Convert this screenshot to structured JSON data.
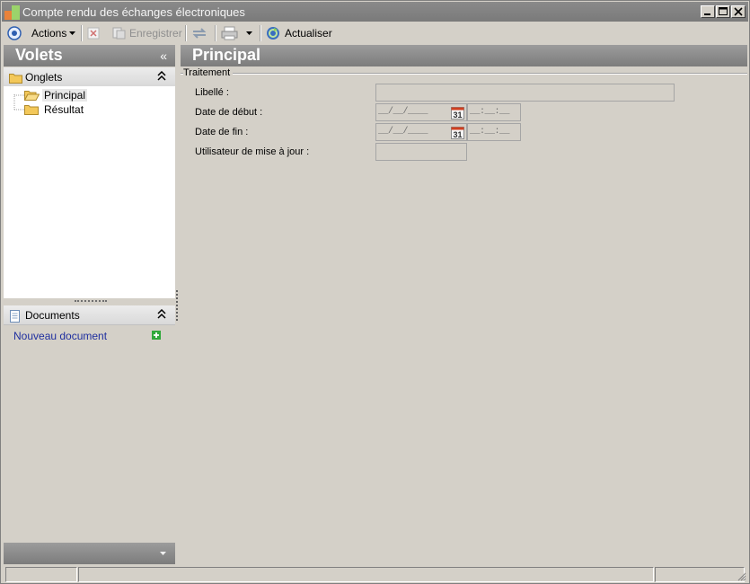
{
  "window": {
    "title": "Compte rendu des échanges électroniques"
  },
  "toolbar": {
    "actions_label": "Actions",
    "save_label": "Enregistrer",
    "refresh_label": "Actualiser"
  },
  "left_panel": {
    "title": "Volets",
    "collapse_glyph": "«",
    "tabs_section": {
      "label": "Onglets",
      "items": [
        {
          "label": "Principal",
          "selected": true
        },
        {
          "label": "Résultat",
          "selected": false
        }
      ]
    },
    "documents_section": {
      "label": "Documents",
      "new_document_label": "Nouveau document"
    }
  },
  "main": {
    "title": "Principal",
    "group_title": "Traitement",
    "fields": {
      "libelle_label": "Libellé :",
      "date_debut_label": "Date de début :",
      "date_fin_label": "Date de fin :",
      "user_label": "Utilisateur de mise à jour :"
    },
    "date_mask": "__/__/____",
    "time_mask": "__:__:__",
    "calendar_day": "31"
  },
  "icons": {
    "app": "app-icon",
    "actions": "circle-target-icon",
    "delete": "delete-icon",
    "save": "save-icon",
    "sync": "sync-icon",
    "print": "print-icon",
    "refresh": "refresh-icon",
    "folder": "folder-icon",
    "document": "document-icon",
    "add": "add-icon",
    "calendar": "calendar-icon"
  },
  "colors": {
    "panel_header": "#8a8a8a",
    "link": "#1f2f9f",
    "calendar_red": "#d04020",
    "add_green": "#2fa83a"
  }
}
